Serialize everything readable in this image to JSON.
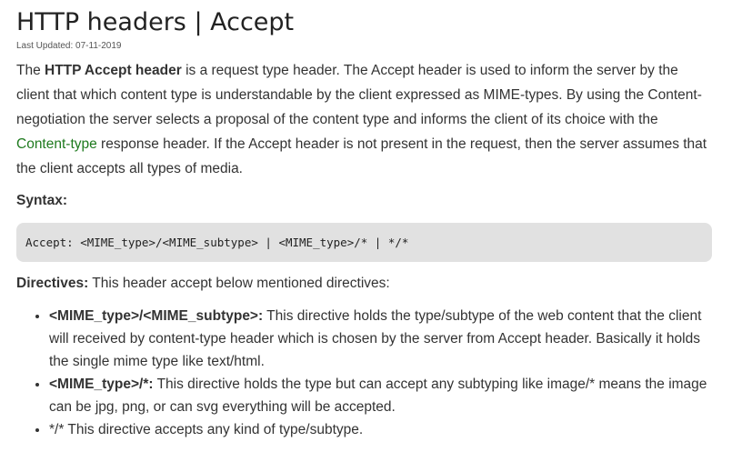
{
  "article": {
    "title": "HTTP headers | Accept",
    "last_updated": "Last Updated: 07-11-2019",
    "intro": {
      "p1_lead": "The ",
      "p1_bold": "HTTP Accept header",
      "p1_rest": " is a request type header. The Accept header is used to inform the server by the client that which content type is understandable by the client expressed as MIME-types. By using the Content-negotiation the server selects a proposal of the content type and informs the client of its choice with the ",
      "link_text": "Content-type",
      "p1_end": " response header. If the Accept header is not present in the request, then the server assumes that the client accepts all types of media."
    },
    "syntax_label": "Syntax:",
    "code": "Accept: <MIME_type>/<MIME_subtype> | <MIME_type>/* | */*",
    "directives_label": "Directives:",
    "directives_text": " This header accept below mentioned directives:",
    "list": [
      {
        "term": "<MIME_type>/<MIME_subtype>:",
        "desc": " This directive holds the type/subtype of the web content that the client will received by content-type header which is chosen by the server from Accept header. Basically it holds the single mime type like text/html."
      },
      {
        "term": "<MIME_type>/*:",
        "desc": " This directive holds the type but can accept any subtyping like image/* means the image can be jpg, png, or can svg everything will be accepted."
      },
      {
        "term": "",
        "desc": "*/* This directive accepts any kind of type/subtype."
      }
    ],
    "colors": {
      "link": "#1e7a1e",
      "code_bg": "#e1e1e1",
      "text": "#333333"
    }
  }
}
